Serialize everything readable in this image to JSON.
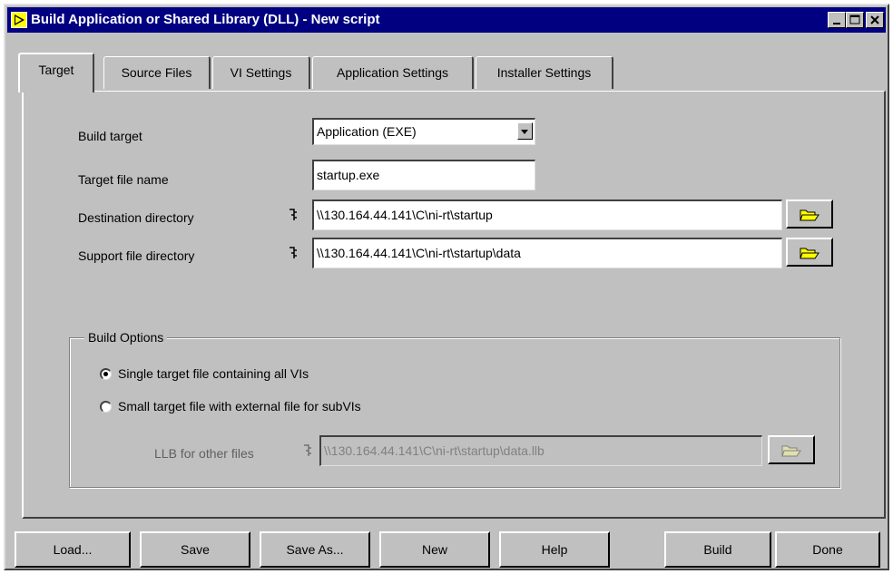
{
  "window": {
    "title": "Build Application or Shared Library (DLL) - New script"
  },
  "tabs": [
    {
      "label": "Target",
      "active": true
    },
    {
      "label": "Source Files"
    },
    {
      "label": "VI Settings"
    },
    {
      "label": "Application Settings"
    },
    {
      "label": "Installer Settings"
    }
  ],
  "target": {
    "build_target_label": "Build target",
    "build_target_value": "Application (EXE)",
    "target_file_name_label": "Target file name",
    "target_file_name_value": "startup.exe",
    "destination_directory_label": "Destination directory",
    "destination_directory_value": "\\\\130.164.44.141\\C\\ni-rt\\startup",
    "support_file_directory_label": "Support file directory",
    "support_file_directory_value": "\\\\130.164.44.141\\C\\ni-rt\\startup\\data",
    "path_glyph": "ꟷ"
  },
  "build_options": {
    "title": "Build Options",
    "option_single": "Single target file containing all VIs",
    "option_small": "Small target file with external file for subVIs",
    "selected": "single",
    "llb_label": "LLB for other files",
    "llb_value": "\\\\130.164.44.141\\C\\ni-rt\\startup\\data.llb"
  },
  "buttons": {
    "load": "Load...",
    "save": "Save",
    "save_as": "Save As...",
    "new": "New",
    "help": "Help",
    "build": "Build",
    "done": "Done"
  },
  "icons": {
    "app": "labview-run-arrow-icon",
    "browse": "folder-open-icon",
    "path": "path-icon"
  },
  "colors": {
    "titlebar": "#000080",
    "face": "#c0c0c0",
    "folder_yellow": "#ffff00"
  }
}
